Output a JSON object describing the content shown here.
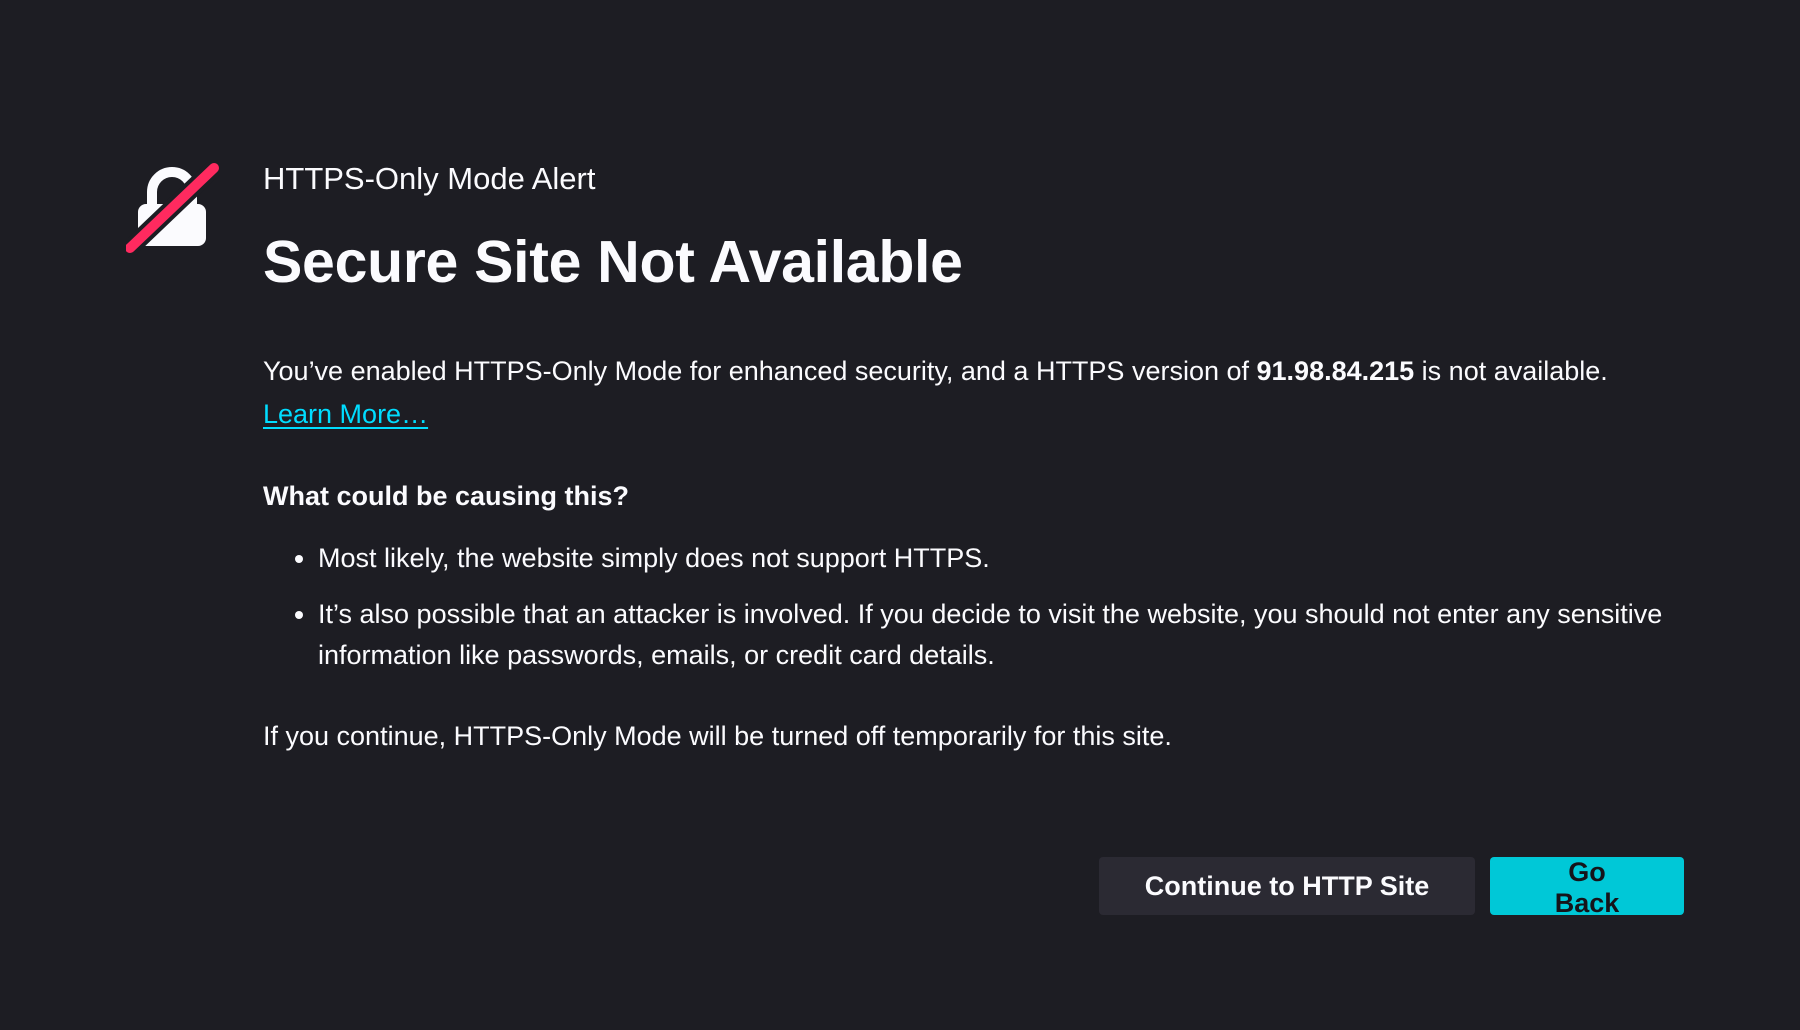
{
  "alert": {
    "title": "HTTPS-Only Mode Alert",
    "heading": "Secure Site Not Available"
  },
  "description": {
    "prefix": "You’ve enabled HTTPS-Only Mode for enhanced security, and a HTTPS version of ",
    "host": "91.98.84.215",
    "suffix": " is not available.",
    "learn_more": "Learn More…"
  },
  "causes": {
    "heading": "What could be causing this?",
    "items": [
      "Most likely, the website simply does not support HTTPS.",
      "It’s also possible that an attacker is involved. If you decide to visit the website, you should not enter any sensitive information like passwords, emails, or credit card details."
    ]
  },
  "continue_note": "If you continue, HTTPS-Only Mode will be turned off temporarily for this site.",
  "buttons": {
    "continue_label": "Continue to HTTP Site",
    "go_back_label": "Go Back"
  },
  "icons": {
    "alert_icon": "crossed-out-lock-icon"
  },
  "colors": {
    "background": "#1d1d23",
    "text": "#fbfbfe",
    "link": "#00ddff",
    "primary_button": "#00c8d7",
    "secondary_button": "#2b2a33",
    "slash": "#ff2a5f"
  }
}
